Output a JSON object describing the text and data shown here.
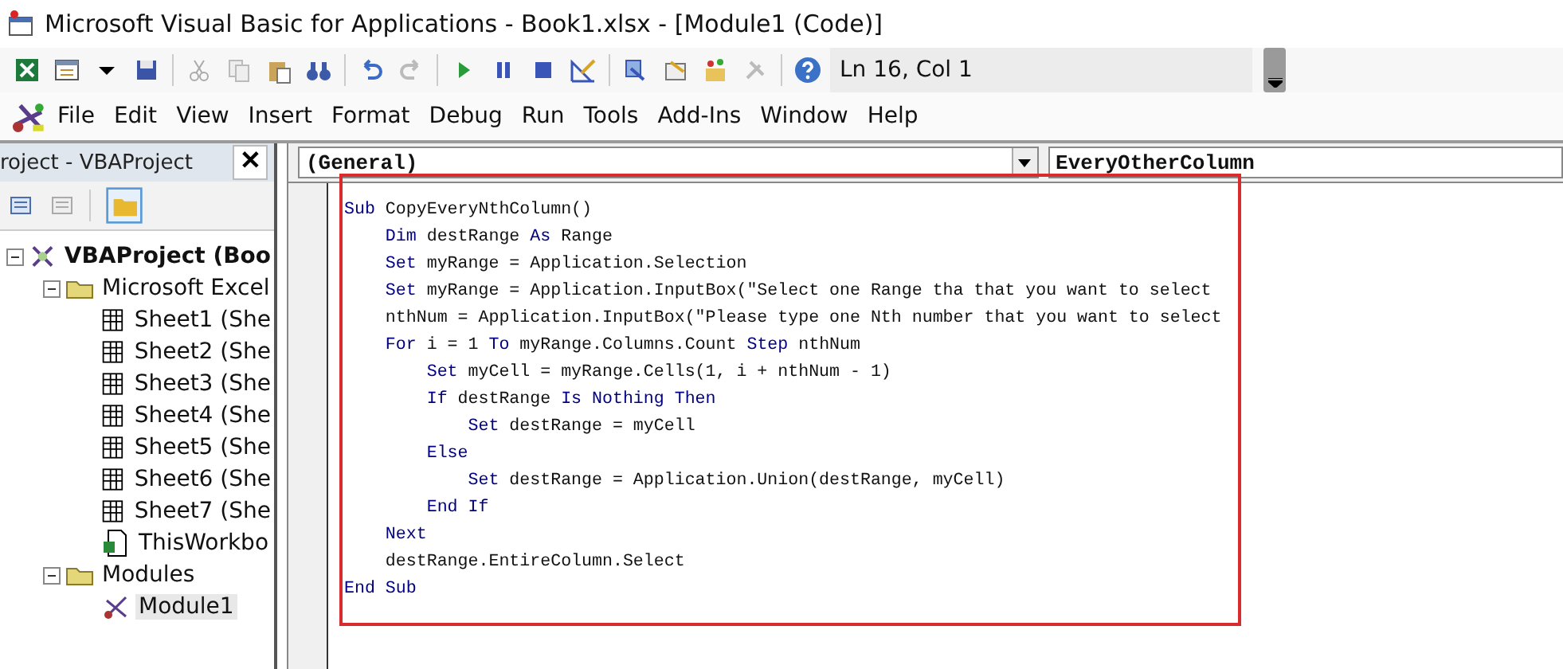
{
  "window": {
    "title": "Microsoft Visual Basic for Applications - Book1.xlsx - [Module1 (Code)]"
  },
  "toolbar": {
    "position": "Ln 16, Col 1"
  },
  "menu": [
    {
      "label": "File"
    },
    {
      "label": "Edit"
    },
    {
      "label": "View"
    },
    {
      "label": "Insert"
    },
    {
      "label": "Format"
    },
    {
      "label": "Debug"
    },
    {
      "label": "Run"
    },
    {
      "label": "Tools"
    },
    {
      "label": "Add-Ins"
    },
    {
      "label": "Window"
    },
    {
      "label": "Help"
    }
  ],
  "project_panel": {
    "title": "roject - VBAProject",
    "close": "✕",
    "tree": [
      {
        "label": "VBAProject (Boo",
        "kind": "project",
        "expanded": true,
        "selected": false,
        "children": [
          {
            "label": "Microsoft Excel",
            "kind": "folder",
            "expanded": true,
            "selected": false,
            "children": [
              {
                "label": "Sheet1 (She",
                "kind": "sheet",
                "selected": false
              },
              {
                "label": "Sheet2 (She",
                "kind": "sheet",
                "selected": false
              },
              {
                "label": "Sheet3 (She",
                "kind": "sheet",
                "selected": false
              },
              {
                "label": "Sheet4 (She",
                "kind": "sheet",
                "selected": false
              },
              {
                "label": "Sheet5 (She",
                "kind": "sheet",
                "selected": false
              },
              {
                "label": "Sheet6 (She",
                "kind": "sheet",
                "selected": false
              },
              {
                "label": "Sheet7 (She",
                "kind": "sheet",
                "selected": false
              },
              {
                "label": "ThisWorkbo",
                "kind": "workbook",
                "selected": false
              }
            ]
          },
          {
            "label": "Modules",
            "kind": "folder",
            "expanded": true,
            "selected": false,
            "children": [
              {
                "label": "Module1",
                "kind": "module",
                "selected": true
              }
            ]
          }
        ]
      }
    ]
  },
  "code_window": {
    "object_dropdown": "(General)",
    "procedure_dropdown": "EveryOtherColumn",
    "lines": [
      [
        {
          "kind": "keyword",
          "text": "Sub"
        },
        {
          "kind": "plain",
          "text": " CopyEveryNthColumn()"
        }
      ],
      [
        {
          "kind": "keyword",
          "text": "    Dim"
        },
        {
          "kind": "plain",
          "text": " destRange "
        },
        {
          "kind": "keyword",
          "text": "As"
        },
        {
          "kind": "plain",
          "text": " Range"
        }
      ],
      [
        {
          "kind": "keyword",
          "text": "    Set"
        },
        {
          "kind": "plain",
          "text": " myRange = Application.Selection"
        }
      ],
      [
        {
          "kind": "keyword",
          "text": "    Set"
        },
        {
          "kind": "plain",
          "text": " myRange = Application.InputBox(\"Select one Range tha that you want to select"
        }
      ],
      [
        {
          "kind": "plain",
          "text": "    nthNum = Application.InputBox(\"Please type one Nth number that you want to select"
        }
      ],
      [
        {
          "kind": "keyword",
          "text": "    For"
        },
        {
          "kind": "plain",
          "text": " i = 1 "
        },
        {
          "kind": "keyword",
          "text": "To"
        },
        {
          "kind": "plain",
          "text": " myRange.Columns.Count "
        },
        {
          "kind": "keyword",
          "text": "Step"
        },
        {
          "kind": "plain",
          "text": " nthNum"
        }
      ],
      [
        {
          "kind": "keyword",
          "text": "        Set"
        },
        {
          "kind": "plain",
          "text": " myCell = myRange.Cells(1, i + nthNum - 1)"
        }
      ],
      [
        {
          "kind": "keyword",
          "text": "        If"
        },
        {
          "kind": "plain",
          "text": " destRange "
        },
        {
          "kind": "keyword",
          "text": "Is Nothing Then"
        }
      ],
      [
        {
          "kind": "keyword",
          "text": "            Set"
        },
        {
          "kind": "plain",
          "text": " destRange = myCell"
        }
      ],
      [
        {
          "kind": "keyword",
          "text": "        Else"
        }
      ],
      [
        {
          "kind": "keyword",
          "text": "            Set"
        },
        {
          "kind": "plain",
          "text": " destRange = Application.Union(destRange, myCell)"
        }
      ],
      [
        {
          "kind": "keyword",
          "text": "        End If"
        }
      ],
      [
        {
          "kind": "keyword",
          "text": "    Next"
        }
      ],
      [
        {
          "kind": "plain",
          "text": "    destRange.EntireColumn.Select"
        }
      ],
      [
        {
          "kind": "keyword",
          "text": "End Sub"
        }
      ]
    ]
  }
}
